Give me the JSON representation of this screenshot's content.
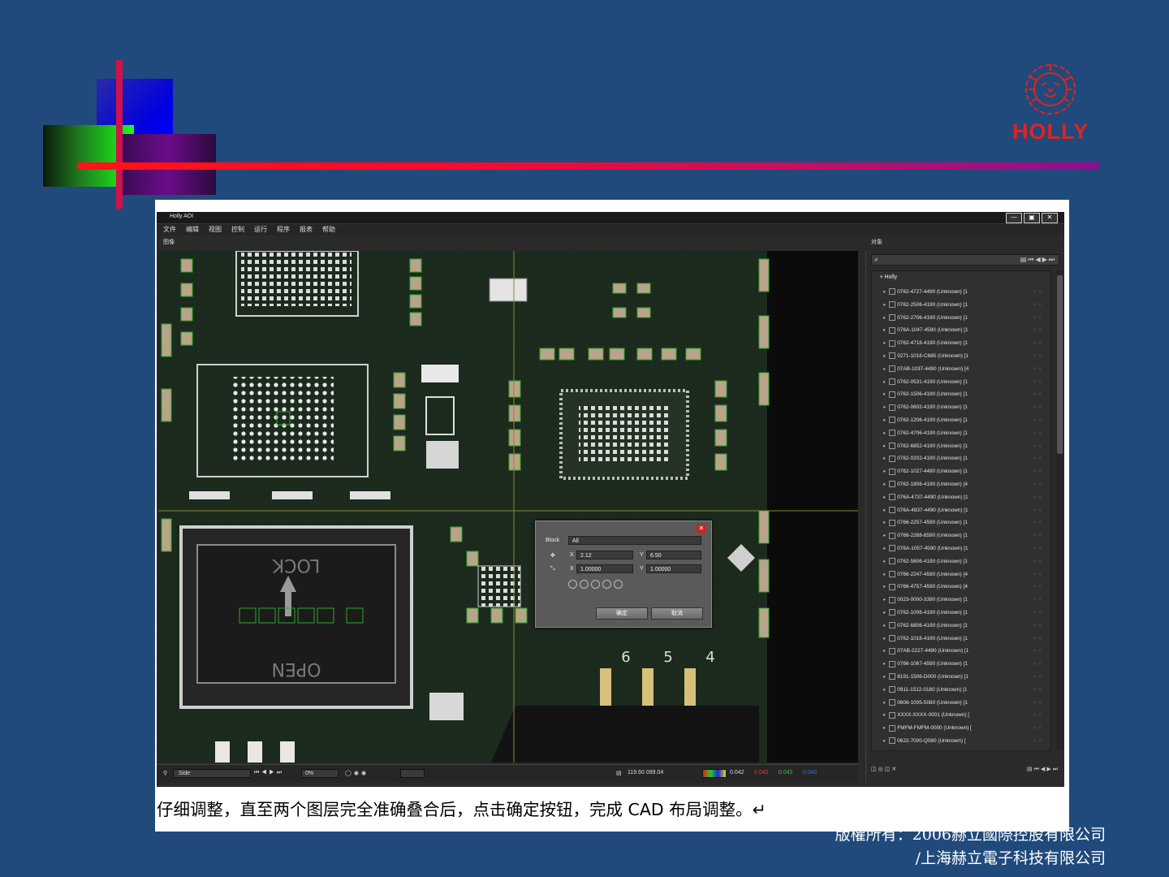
{
  "logo": {
    "text": "HOLLY",
    "icon": "lion-head-icon",
    "color": "#e0231f"
  },
  "app": {
    "window_title": "Holly AOI",
    "window_buttons": [
      "—",
      "▣",
      "✕"
    ],
    "menu": [
      "文件",
      "编辑",
      "视图",
      "控制",
      "运行",
      "程序",
      "报表",
      "帮助"
    ],
    "image_panel_title": "图像",
    "object_panel_title": "对象"
  },
  "board": {
    "silkscreen_open": "OPEN",
    "silkscreen_lock": "LOCK",
    "pin_numbers": [
      "6",
      "5",
      "4"
    ]
  },
  "dialog": {
    "block_label": "Block",
    "block_value": "All",
    "x_offset": "2.12",
    "y_offset": "6.50",
    "x_scale": "1.00000",
    "y_scale": "1.00000",
    "ok_label": "确定",
    "cancel_label": "取消"
  },
  "statusbar": {
    "mode": "Side",
    "zoom": "0%",
    "coords": "119.60   099.04",
    "value_1": "0.042",
    "value_2": "0.042",
    "value_3": "0.042",
    "value_4": "0.042"
  },
  "tree": {
    "root": "Holly",
    "items": [
      "0762-4727-4490 (Unknown) [1",
      "0762-2506-4190 (Unknown) [1",
      "0762-2706-4190 (Unknown) [1",
      "076A-1047-4590 (Unknown) [1",
      "0762-4718-4190 (Unknown) [1",
      "0271-1018-C885 (Unknown) [1",
      "07AB-1037-4490 (Unknown) [4",
      "0762-0531-4190 (Unknown) [1",
      "0762-1506-4190 (Unknown) [1",
      "0762-0602-4190 (Unknown) [1",
      "0762-1206-4190 (Unknown) [1",
      "0762-4706-4190 (Unknown) [1",
      "0762-6852-4190 (Unknown) [1",
      "0762-0202-4190 (Unknown) [1",
      "0762-1027-4490 (Unknown) [1",
      "0762-1806-4190 (Unknown) [4",
      "076A-4737-4490 (Unknown) [1",
      "076A-4837-4490 (Unknown) [1",
      "0766-2257-4590 (Unknown) [1",
      "0766-2268-8590 (Unknown) [1",
      "076A-1057-4590 (Unknown) [1",
      "0762-5606-4190 (Unknown) [1",
      "0766-2247-4590 (Unknown) [4",
      "0766-4757-4590 (Unknown) [4",
      "0023-0000-3390 (Unknown) [1",
      "0762-1006-4190 (Unknown) [1",
      "0762-6806-4190 (Unknown) [1",
      "0762-1018-4190 (Unknown) [1",
      "07AB-2227-4490 (Unknown) [1",
      "0766-1067-4590 (Unknown) [1",
      "8191-1506-D000 (Unknown) [1",
      "0911-1512-0180 (Unknown) [1",
      "0608-1005-5080 (Unknown) [1",
      "XXXX-XXXX-0001 (Unknown) [",
      "FMFM-FMFM-0000 (Unknown) [",
      "0622-7000-Q080 (Unknown) ["
    ]
  },
  "caption": "仔细调整，直至两个图层完全准确叠合后，点击确定按钮，完成 CAD 布局调整。↵",
  "copyright": {
    "line1": "版權所有：2006赫立國際控股有限公司",
    "line2": "/上海赫立電子科技有限公司"
  }
}
